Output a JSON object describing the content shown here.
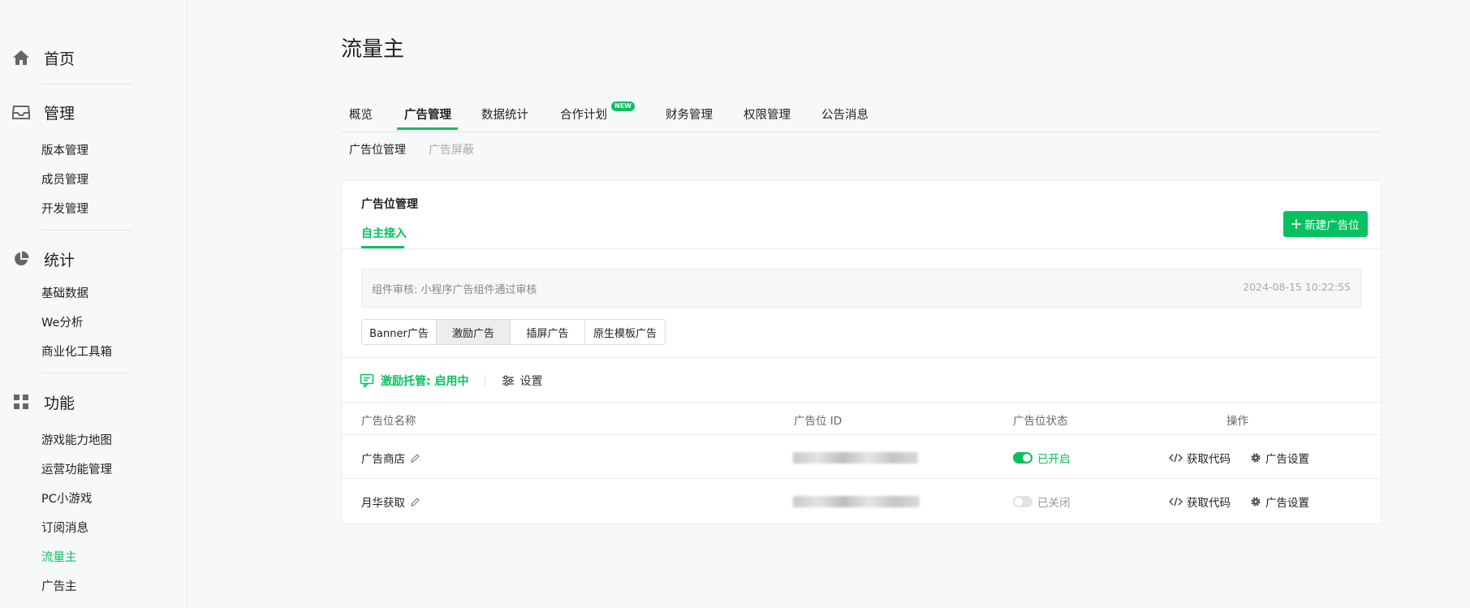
{
  "sidebar": {
    "groups": [
      {
        "label": "首页",
        "icon": "home-icon"
      },
      {
        "label": "管理",
        "icon": "inbox-icon",
        "items": [
          "版本管理",
          "成员管理",
          "开发管理"
        ]
      },
      {
        "label": "统计",
        "icon": "pie-chart-icon",
        "items": [
          "基础数据",
          "We分析",
          "商业化工具箱"
        ]
      },
      {
        "label": "功能",
        "icon": "grid-icon",
        "items": [
          "游戏能力地图",
          "运营功能管理",
          "PC小游戏",
          "订阅消息",
          "流量主",
          "广告主"
        ]
      }
    ],
    "active_item": "流量主"
  },
  "page_title": "流量主",
  "tabs": [
    "概览",
    "广告管理",
    "数据统计",
    "合作计划",
    "财务管理",
    "权限管理",
    "公告消息"
  ],
  "active_tab": "广告管理",
  "new_badge": "NEW",
  "subtabs": [
    "广告位管理",
    "广告屏蔽"
  ],
  "card": {
    "title": "广告位管理",
    "tab": "自主接入",
    "new_button": "新建广告位",
    "notice_text": "组件审核: 小程序广告组件通过审核",
    "notice_time": "2024-08-15 10:22:55",
    "ad_types": [
      "Banner广告",
      "激励广告",
      "插屏广告",
      "原生模板广告"
    ],
    "selected_ad_type": "激励广告",
    "managed_label": "激励托管: 启用中",
    "settings_label": "设置",
    "columns": [
      "广告位名称",
      "广告位 ID",
      "广告位状态",
      "操作"
    ],
    "rows": [
      {
        "name": "广告商店",
        "status": "已开启",
        "enabled": true,
        "get_code": "获取代码",
        "ad_settings": "广告设置"
      },
      {
        "name": "月华获取",
        "status": "已关闭",
        "enabled": false,
        "get_code": "获取代码",
        "ad_settings": "广告设置"
      }
    ]
  },
  "colors": {
    "accent": "#07c160",
    "background": "#f7f8fa"
  }
}
